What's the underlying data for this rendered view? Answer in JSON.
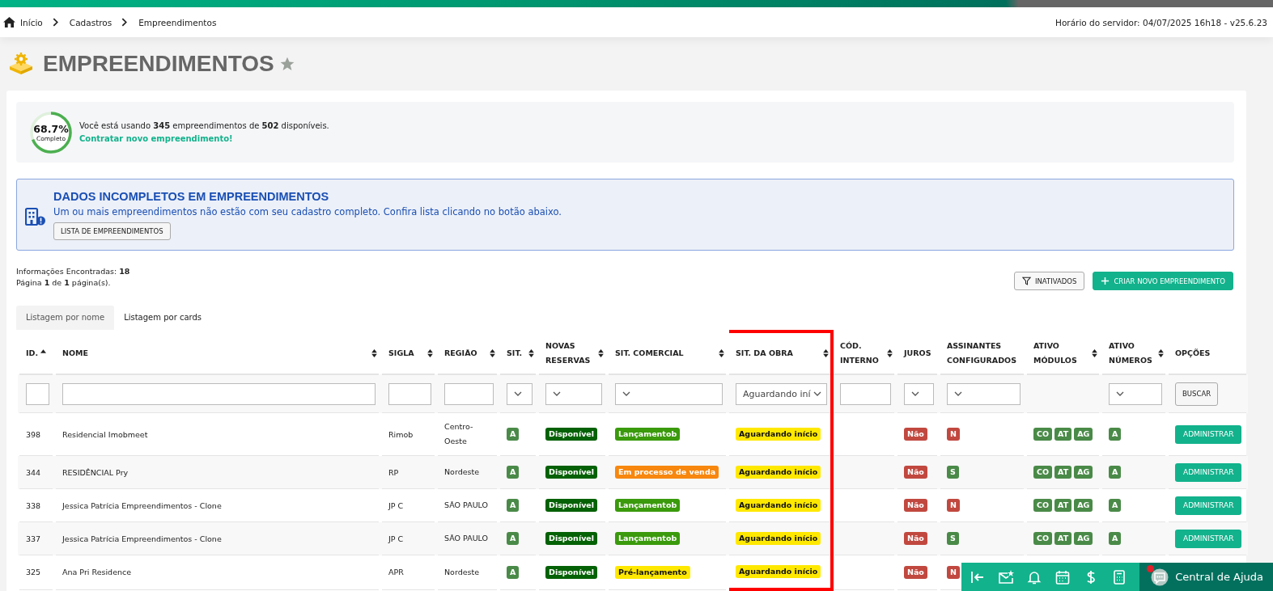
{
  "breadcrumb": [
    "Início",
    "Cadastros",
    "Empreendimentos"
  ],
  "server_time": "Horário do servidor: 04/07/2025 16h18 - v25.6.23",
  "page_title": "EMPREENDIMENTOS",
  "usage": {
    "level": 0.687,
    "percent": "68.7%",
    "caption": "Completo",
    "text": "Você está usando **345** empreendimentos de **502** disponíveis.",
    "link": "Contratar novo empreendimento!"
  },
  "alert": {
    "title": "DADOS INCOMPLETOS EM EMPREENDIMENTOS",
    "message": "Um ou mais empreendimentos não estão com seu cadastro completo. Confira lista clicando no botão abaixo.",
    "button": "LISTA DE EMPREENDIMENTOS"
  },
  "summary": [
    "Informações Encontradas: **18**",
    "Página **1** de **1** página(s)."
  ],
  "buttons": {
    "inactive": "INATIVADOS",
    "create": "CRIAR NOVO EMPREENDIMENTO"
  },
  "tabs": [
    {
      "label": "Listagem por nome",
      "selected": true
    },
    {
      "label": "Listagem por cards",
      "selected": false
    }
  ],
  "columns": [
    {
      "label": "ID.",
      "sort": {
        "kind": "asc"
      },
      "filter": {
        "kind": "text"
      },
      "highlighted": false
    },
    {
      "label": "NOME",
      "sort": {
        "kind": "both"
      },
      "filter": {
        "kind": "text"
      },
      "highlighted": false
    },
    {
      "label": "SIGLA",
      "sort": {
        "kind": "both"
      },
      "filter": {
        "kind": "text"
      },
      "highlighted": false
    },
    {
      "label": "REGIÃO",
      "sort": {
        "kind": "both"
      },
      "filter": {
        "kind": "text"
      },
      "highlighted": false
    },
    {
      "label": "SIT.",
      "sort": {
        "kind": "both"
      },
      "filter": {
        "kind": "select"
      },
      "highlighted": false
    },
    {
      "label": "NOVAS RESERVAS",
      "sort": {
        "kind": "both"
      },
      "filter": {
        "kind": "select"
      },
      "highlighted": false
    },
    {
      "label": "SIT. COMERCIAL",
      "sort": {
        "kind": "both"
      },
      "filter": {
        "kind": "select"
      },
      "highlighted": false
    },
    {
      "label": "SIT. DA OBRA",
      "sort": {
        "kind": "both"
      },
      "filter": {
        "kind": "select",
        "value": "Aguardando iní"
      },
      "highlighted": true
    },
    {
      "label": "CÓD. INTERNO",
      "sort": {
        "kind": "both"
      },
      "filter": {
        "kind": "text"
      },
      "highlighted": false
    },
    {
      "label": "JUROS",
      "sort": {
        "kind": "none"
      },
      "filter": {
        "kind": "select"
      },
      "highlighted": false
    },
    {
      "label": "ASSINANTES CONFIGURADOS",
      "sort": {
        "kind": "none"
      },
      "filter": {
        "kind": "select"
      },
      "highlighted": false
    },
    {
      "label": "ATIVO MÓDULOS",
      "sort": {
        "kind": "both"
      },
      "filter": {
        "kind": "none"
      },
      "highlighted": false
    },
    {
      "label": "ATIVO NÚMEROS",
      "sort": {
        "kind": "both"
      },
      "filter": {
        "kind": "select"
      },
      "highlighted": false
    },
    {
      "label": "OPÇÕES",
      "sort": {
        "kind": "none"
      },
      "filter": {
        "kind": "button",
        "label": "BUSCAR"
      },
      "highlighted": false
    }
  ],
  "rows": [
    {
      "id": "398",
      "nome": "Residencial Imobmeet",
      "sigla": "Rimob",
      "regiao": "Centro-Oeste",
      "sit": "A",
      "novas_reservas": "Disponível",
      "sit_comercial": {
        "text": "Lançamentob",
        "color": "#3a9a0c"
      },
      "sit_obra": "Aguardando início",
      "juros": "Não",
      "assinantes": {
        "text": "N",
        "color": "#c1483f"
      },
      "modulos": [
        "CO",
        "AT",
        "AG"
      ],
      "numeros": "A",
      "action": "ADMINISTRAR"
    },
    {
      "id": "344",
      "nome": "RESIDÊNCIAL Pry",
      "sigla": "RP",
      "regiao": "Nordeste",
      "sit": "A",
      "novas_reservas": "Disponível",
      "sit_comercial": {
        "text": "Em processo de venda",
        "color": "#f7870e"
      },
      "sit_obra": "Aguardando início",
      "juros": "Não",
      "assinantes": {
        "text": "S",
        "color": "#4a8a48"
      },
      "modulos": [
        "CO",
        "AT",
        "AG"
      ],
      "numeros": "A",
      "action": "ADMINISTRAR"
    },
    {
      "id": "338",
      "nome": "Jessica Patrícia Empreendimentos - Clone",
      "sigla": "JP C",
      "regiao": "SÃO PAULO",
      "sit": "A",
      "novas_reservas": "Disponível",
      "sit_comercial": {
        "text": "Lançamentob",
        "color": "#3a9a0c"
      },
      "sit_obra": "Aguardando início",
      "juros": "Não",
      "assinantes": {
        "text": "N",
        "color": "#c1483f"
      },
      "modulos": [
        "CO",
        "AT",
        "AG"
      ],
      "numeros": "A",
      "action": "ADMINISTRAR"
    },
    {
      "id": "337",
      "nome": "Jessica Patrícia Empreendimentos - Clone",
      "sigla": "JP C",
      "regiao": "SÃO PAULO",
      "sit": "A",
      "novas_reservas": "Disponível",
      "sit_comercial": {
        "text": "Lançamentob",
        "color": "#3a9a0c"
      },
      "sit_obra": "Aguardando início",
      "juros": "Não",
      "assinantes": {
        "text": "S",
        "color": "#4a8a48"
      },
      "modulos": [
        "CO",
        "AT",
        "AG"
      ],
      "numeros": "A",
      "action": "ADMINISTRAR"
    },
    {
      "id": "325",
      "nome": "Ana Pri Residence",
      "sigla": "APR",
      "regiao": "Nordeste",
      "sit": "A",
      "novas_reservas": "Disponível",
      "sit_comercial": {
        "text": "Pré-lançamento",
        "color": "#ffe800"
      },
      "sit_obra": "Aguardando início",
      "juros": "Não",
      "assinantes": {
        "text": "N",
        "color": "#c1483f"
      }
    }
  ],
  "help": {
    "label": "Central de Ajuda",
    "notification": true
  }
}
